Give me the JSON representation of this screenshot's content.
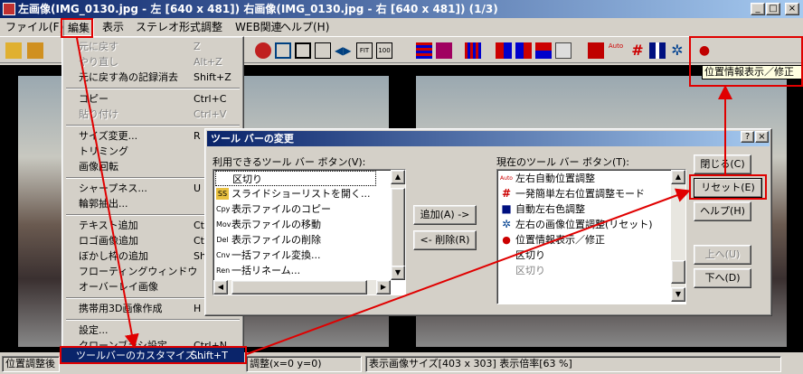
{
  "window": {
    "title": "左画像(IMG_0130.jpg - 左 [640 x 481]) 右画像(IMG_0130.jpg - 右 [640 x 481])  (1/3)",
    "min": "_",
    "max": "□",
    "close": "×"
  },
  "menubar": [
    "ファイル(F)",
    "編集",
    "表示",
    "ステレオ形式",
    "調整",
    "WEB関連",
    "ヘルプ(H)"
  ],
  "tooltip": "位置情報表示／修正",
  "edit_menu": [
    {
      "label": "元に戻す",
      "shortcut": "Z",
      "disabled": true
    },
    {
      "label": "やり直し",
      "shortcut": "Alt+Z",
      "disabled": true
    },
    {
      "label": "元に戻す為の記録消去",
      "shortcut": "Shift+Z"
    },
    {
      "label": "コピー",
      "shortcut": "Ctrl+C"
    },
    {
      "label": "貼り付け",
      "shortcut": "Ctrl+V",
      "disabled": true
    },
    {
      "label": "サイズ変更...",
      "shortcut": "R"
    },
    {
      "label": "トリミング",
      "shortcut": ""
    },
    {
      "label": "画像回転",
      "shortcut": ""
    },
    {
      "label": "シャープネス...",
      "shortcut": "U"
    },
    {
      "label": "輪郭抽出...",
      "shortcut": ""
    },
    {
      "label": "テキスト追加",
      "shortcut": "Ct"
    },
    {
      "label": "ロゴ画像追加",
      "shortcut": "Ct"
    },
    {
      "label": "ぼかし枠の追加",
      "shortcut": "Sh"
    },
    {
      "label": "フローティングウィンドウ",
      "shortcut": ""
    },
    {
      "label": "オーバーレイ画像",
      "shortcut": ""
    },
    {
      "label": "携帯用3D画像作成",
      "shortcut": "H"
    },
    {
      "label": "設定...",
      "shortcut": ""
    },
    {
      "label": "クローンブラシ設定",
      "shortcut": "Ctrl+N"
    },
    {
      "label": "ツールバーのカスタマイズ...",
      "shortcut": "Shift+T"
    }
  ],
  "dialog": {
    "title": "ツール バーの変更",
    "help_q": "?",
    "close_x": "×",
    "available_label": "利用できるツール バー ボタン(V):",
    "current_label": "現在のツール バー ボタン(T):",
    "available": [
      {
        "icon": "",
        "label": "区切り"
      },
      {
        "icon": "SS",
        "label": "スライドショーリストを開く..."
      },
      {
        "icon": "Cpy",
        "label": "表示ファイルのコピー"
      },
      {
        "icon": "Mov",
        "label": "表示ファイルの移動"
      },
      {
        "icon": "Del",
        "label": "表示ファイルの削除"
      },
      {
        "icon": "Cnv",
        "label": "一括ファイル変換..."
      },
      {
        "icon": "Ren",
        "label": "一括リネーム..."
      }
    ],
    "current": [
      {
        "icon": "Auto",
        "label": "左右自動位置調整"
      },
      {
        "icon": "#",
        "label": "一発簡単左右位置調整モード"
      },
      {
        "icon": "■",
        "label": "自動左右色調整"
      },
      {
        "icon": "✲",
        "label": "左右の画像位置調整(リセット)"
      },
      {
        "icon": "●",
        "label": "位置情報表示／修正"
      },
      {
        "icon": "",
        "label": "区切り"
      },
      {
        "icon": "",
        "label": "区切り"
      }
    ],
    "add_button": "追加(A) ->",
    "remove_button": "<- 削除(R)",
    "close_button": "閉じる(C)",
    "reset_button": "リセット(E)",
    "help_button": "ヘルプ(H)",
    "up_button": "上へ(U)",
    "down_button": "下へ(D)"
  },
  "status": {
    "left": "位置調整後",
    "mid": "調整(x=0 y=0)",
    "right": "表示画像サイズ[403 x 303] 表示倍率[63 %]"
  }
}
